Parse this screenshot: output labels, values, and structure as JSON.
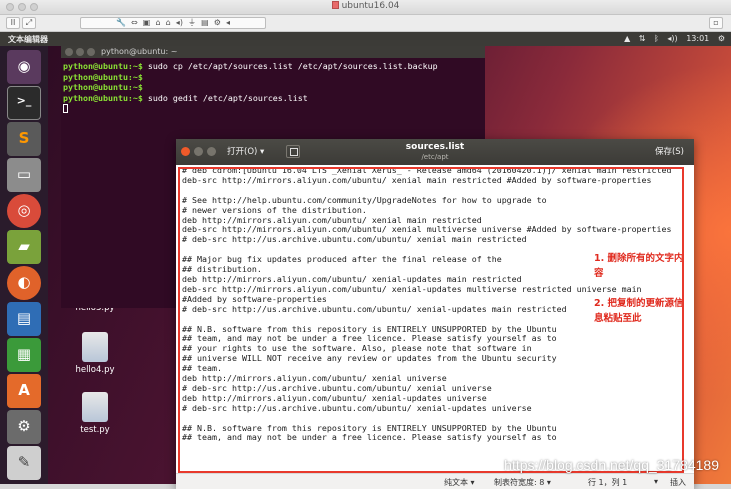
{
  "host": {
    "title": "ubuntu16.04",
    "pause_label": "II",
    "toolbar_icons": [
      "wrench-icon",
      "arrows-icon",
      "snapshot-icon",
      "disk-icon",
      "disk-icon",
      "speaker-icon",
      "usb-icon",
      "save-icon",
      "settings-icon",
      "arrow-left-icon"
    ],
    "right_icon": "window-icon"
  },
  "topbar": {
    "app_title": "文本编辑器",
    "time": "13:01",
    "indicators": [
      "dropbox-icon",
      "network-icon",
      "bluetooth-icon",
      "volume-icon",
      "gear-icon"
    ]
  },
  "launcher": {
    "items": [
      "ubuntu-dash",
      "terminal",
      "sublime-text",
      "file-manager",
      "chrome",
      "book-reader",
      "firefox",
      "writer",
      "calc",
      "software-center",
      "system-settings",
      "text-editor",
      "trash"
    ]
  },
  "desktop_icons": [
    {
      "label": "hello3.py"
    },
    {
      "label": "hello4.py"
    },
    {
      "label": "test.py"
    }
  ],
  "terminal": {
    "title": "python@ubuntu: ~",
    "lines": [
      {
        "prompt": "python@ubuntu:~$",
        "cmd": " sudo cp /etc/apt/sources.list /etc/apt/sources.list.backup"
      },
      {
        "prompt": "python@ubuntu:~$",
        "cmd": ""
      },
      {
        "prompt": "python@ubuntu:~$",
        "cmd": ""
      },
      {
        "prompt": "python@ubuntu:~$",
        "cmd": " sudo gedit /etc/apt/sources.list"
      }
    ]
  },
  "gedit": {
    "open_label": "打开(O) ▾",
    "title": "sources.list",
    "path": "/etc/apt",
    "save_label": "保存(S)",
    "lines": [
      "# deb cdrom:[Ubuntu 16.04 LTS _Xenial Xerus_ - Release amd64 (20160420.1)]/ xenial main restricted",
      "deb-src http://mirrors.aliyun.com/ubuntu/ xenial main restricted #Added by software-properties",
      "",
      "# See http://help.ubuntu.com/community/UpgradeNotes for how to upgrade to",
      "# newer versions of the distribution.",
      "deb http://mirrors.aliyun.com/ubuntu/ xenial main restricted",
      "deb-src http://mirrors.aliyun.com/ubuntu/ xenial multiverse universe #Added by software-properties",
      "# deb-src http://us.archive.ubuntu.com/ubuntu/ xenial main restricted",
      "",
      "## Major bug fix updates produced after the final release of the",
      "## distribution.",
      "deb http://mirrors.aliyun.com/ubuntu/ xenial-updates main restricted",
      "deb-src http://mirrors.aliyun.com/ubuntu/ xenial-updates multiverse restricted universe main",
      "#Added by software-properties",
      "# deb-src http://us.archive.ubuntu.com/ubuntu/ xenial-updates main restricted",
      "",
      "## N.B. software from this repository is ENTIRELY UNSUPPORTED by the Ubuntu",
      "## team, and may not be under a free licence. Please satisfy yourself as to",
      "## your rights to use the software. Also, please note that software in",
      "## universe WILL NOT receive any review or updates from the Ubuntu security",
      "## team.",
      "deb http://mirrors.aliyun.com/ubuntu/ xenial universe",
      "# deb-src http://us.archive.ubuntu.com/ubuntu/ xenial universe",
      "deb http://mirrors.aliyun.com/ubuntu/ xenial-updates universe",
      "# deb-src http://us.archive.ubuntu.com/ubuntu/ xenial-updates universe",
      "",
      "## N.B. software from this repository is ENTIRELY UNSUPPORTED by the Ubuntu",
      "## team, and may not be under a free licence. Please satisfy yourself as to"
    ],
    "annotation_1": "1. 删除所有的文字内容",
    "annotation_2": "2. 把复制的更新源信息粘贴至此",
    "status": {
      "syntax": "纯文本 ▾",
      "tab_width": "制表符宽度: 8 ▾",
      "position": "行 1，列 1",
      "mode_dropdown": "▾",
      "insert": "插入"
    }
  },
  "watermark": "https://blog.csdn.net/qq_31784189",
  "colors": {
    "annotation": "#e02a1e",
    "terminal_bg": "#300a24",
    "prompt": "#8ae234"
  }
}
